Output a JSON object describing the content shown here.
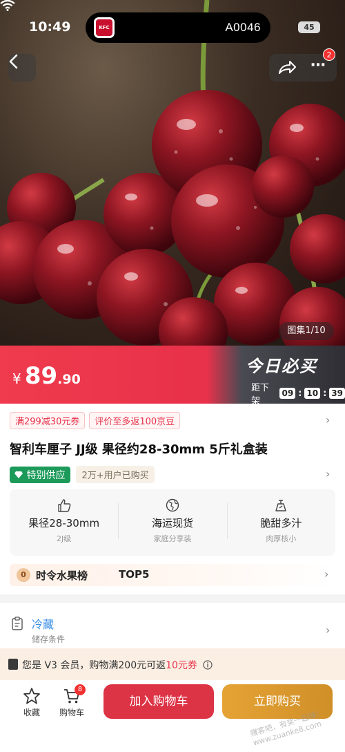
{
  "status": {
    "time": "10:49",
    "island_code": "A0046",
    "battery": "45",
    "island_logo": "KFC"
  },
  "nav": {
    "more_badge": "2"
  },
  "gallery": "图集1/10",
  "price": {
    "yen": "¥",
    "int": "89",
    "dec": ".90"
  },
  "promo": {
    "daily": "今日必买",
    "countdown_label": "距下架",
    "h": "09",
    "m": "10",
    "s": "39"
  },
  "coupons": [
    "满299减30元券",
    "评价至多返100京豆"
  ],
  "title": "智利车厘子 JJ级  果径约28-30mm 5斤礼盒装",
  "tags": {
    "special": "特别供应",
    "buyers": "2万+用户已购买"
  },
  "features": [
    {
      "icon": "thumbs-up-icon",
      "main": "果径28-30mm",
      "sub": "2J级"
    },
    {
      "icon": "globe-ship-icon",
      "main": "海运现货",
      "sub": "家庭分享装"
    },
    {
      "icon": "scale-icon",
      "main": "脆甜多汁",
      "sub": "肉厚核小"
    }
  ],
  "rank": {
    "medal": "0",
    "text": "时令水果榜",
    "top": "TOP5"
  },
  "storage": {
    "main": "冷藏",
    "sub": "储存条件"
  },
  "member": {
    "prefix": "您是 V3 会员，购物满200元可返",
    "highlight": "10元券"
  },
  "bottom": {
    "fav": "收藏",
    "cart": "购物车",
    "cart_badge": "8",
    "add_cart": "加入购物车",
    "buy_now": "立即购买"
  },
  "watermark": "赚客吧，有奖一起赚！www.zuanke8.com",
  "colors": {
    "accent_red": "#e8314a",
    "buy_gold": "#d99a2e",
    "green_tag": "#1c9a5a"
  }
}
